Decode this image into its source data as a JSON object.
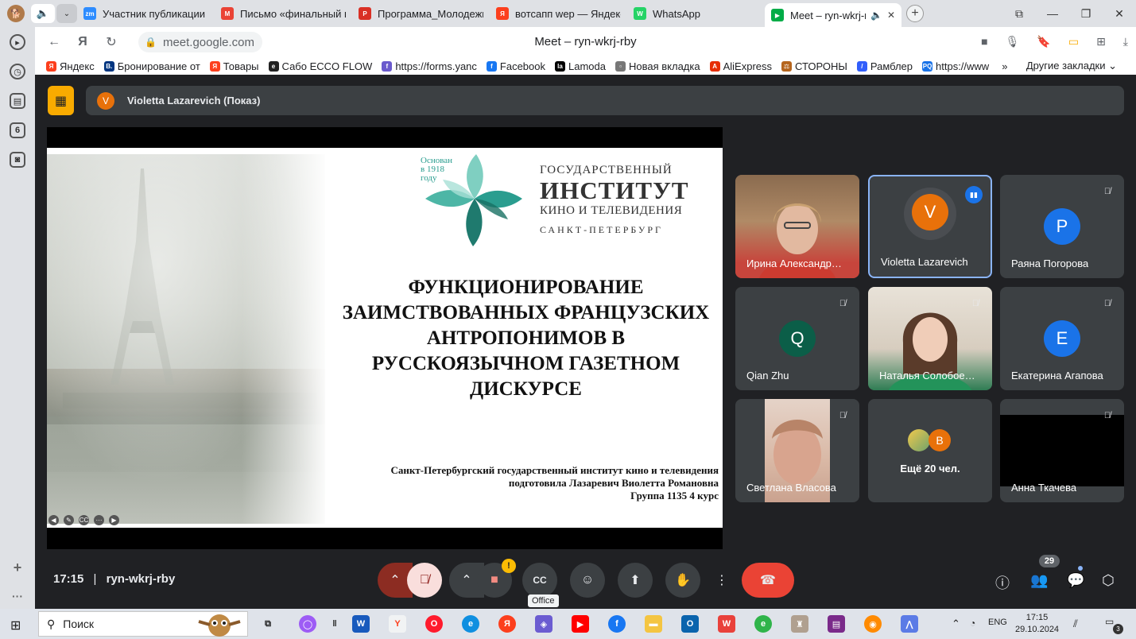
{
  "browser": {
    "tabs": [
      {
        "label": "Участник публикации -",
        "fav": "zm",
        "fav_color": "#2d8cff"
      },
      {
        "label": "Письмо «финальный ва",
        "fav": "M",
        "fav_color": "#ea4335"
      },
      {
        "label": "Программа_Молодежн",
        "fav": "P",
        "fav_color": "#d93025"
      },
      {
        "label": "вотсапп wep — Яндекс",
        "fav": "Я",
        "fav_color": "#fc3f1d"
      },
      {
        "label": "WhatsApp",
        "fav": "W",
        "fav_color": "#25d366"
      }
    ],
    "active_tab": {
      "label": "Meet – ryn-wkrj-rb",
      "fav_color": "#00ac47"
    },
    "url": "meet.google.com",
    "page_title": "Meet – ryn-wkrj-rby",
    "bookmarks": [
      {
        "label": "Яндекс",
        "color": "#fc3f1d",
        "glyph": "Я"
      },
      {
        "label": "Бронирование от",
        "color": "#003580",
        "glyph": "B."
      },
      {
        "label": "Товары",
        "color": "#fc3f1d",
        "glyph": "Я"
      },
      {
        "label": "Сабо ECCO FLOW",
        "color": "#222222",
        "glyph": "e"
      },
      {
        "label": "https://forms.yanc",
        "color": "#6a5acd",
        "glyph": "f"
      },
      {
        "label": "Facebook",
        "color": "#1877f2",
        "glyph": "f"
      },
      {
        "label": "Lamoda",
        "color": "#000000",
        "glyph": "la"
      },
      {
        "label": "Новая вкладка",
        "color": "#777777",
        "glyph": "▫"
      },
      {
        "label": "AliExpress",
        "color": "#e62e04",
        "glyph": "A"
      },
      {
        "label": "СТОРОНЫ",
        "color": "#b5651d",
        "glyph": "⚖"
      },
      {
        "label": "Рамблер",
        "color": "#315efb",
        "glyph": "/"
      },
      {
        "label": "https://www",
        "color": "#1a73e8",
        "glyph": "PQ"
      }
    ],
    "bookmarks_more": "»",
    "other_bookmarks": "Другие закладки"
  },
  "sidebar": {
    "tab_count": "6"
  },
  "presenter_bar": {
    "avatar": "V",
    "name": "Violetta Lazarevich (Показ)"
  },
  "slide": {
    "founded": [
      "Основан",
      "в 1918",
      "году"
    ],
    "logo_lines": [
      "ГОСУДАРСТВЕННЫЙ",
      "ИНСТИТУТ",
      "КИНО И ТЕЛЕВИДЕНИЯ",
      "САНКТ-ПЕТЕРБУРГ"
    ],
    "title_lines": [
      "ФУНКЦИОНИРОВАНИЕ",
      "ЗАИМСТВОВАННЫХ ФРАНЦУЗСКИХ",
      "АНТРОПОНИМОВ В",
      "РУССКОЯЗЫЧНОМ ГАЗЕТНОМ",
      "ДИСКУРСЕ"
    ],
    "author_lines": [
      "Санкт-Петербургский государственный институт кино и телевидения",
      "подготовила Лазаревич Виолетта Романовна",
      "Группа 1135 4 курс"
    ]
  },
  "participants": [
    {
      "name": "Ирина Александр…",
      "type": "video",
      "muted": false
    },
    {
      "name": "Violetta Lazarevich",
      "type": "avatar",
      "avatar": "V",
      "color": "#e8710a",
      "speaking": true
    },
    {
      "name": "Раяна Погорова",
      "type": "avatar",
      "avatar": "P",
      "color": "#1a73e8",
      "muted": true
    },
    {
      "name": "Qian Zhu",
      "type": "avatar",
      "avatar": "Q",
      "color": "#0b5e48",
      "muted": true
    },
    {
      "name": "Наталья Солобое…",
      "type": "video",
      "muted": true
    },
    {
      "name": "Екатерина Агапова",
      "type": "avatar",
      "avatar": "E",
      "color": "#1a73e8",
      "muted": true
    },
    {
      "name": "Светлана Власова",
      "type": "video",
      "muted": true
    },
    {
      "name": "Ещё 20 чел.",
      "type": "more",
      "avatar": "B",
      "color": "#e8710a"
    },
    {
      "name": "Анна Ткачева",
      "type": "black",
      "muted": true
    }
  ],
  "meeting": {
    "time": "17:15",
    "separator": "|",
    "code": "ryn-wkrj-rby",
    "participant_count": "29",
    "tooltip": "Office"
  },
  "taskbar": {
    "search_placeholder": "Поиск",
    "lang": "ENG",
    "time": "17:15",
    "date": "29.10.2024",
    "notifications": "3"
  }
}
